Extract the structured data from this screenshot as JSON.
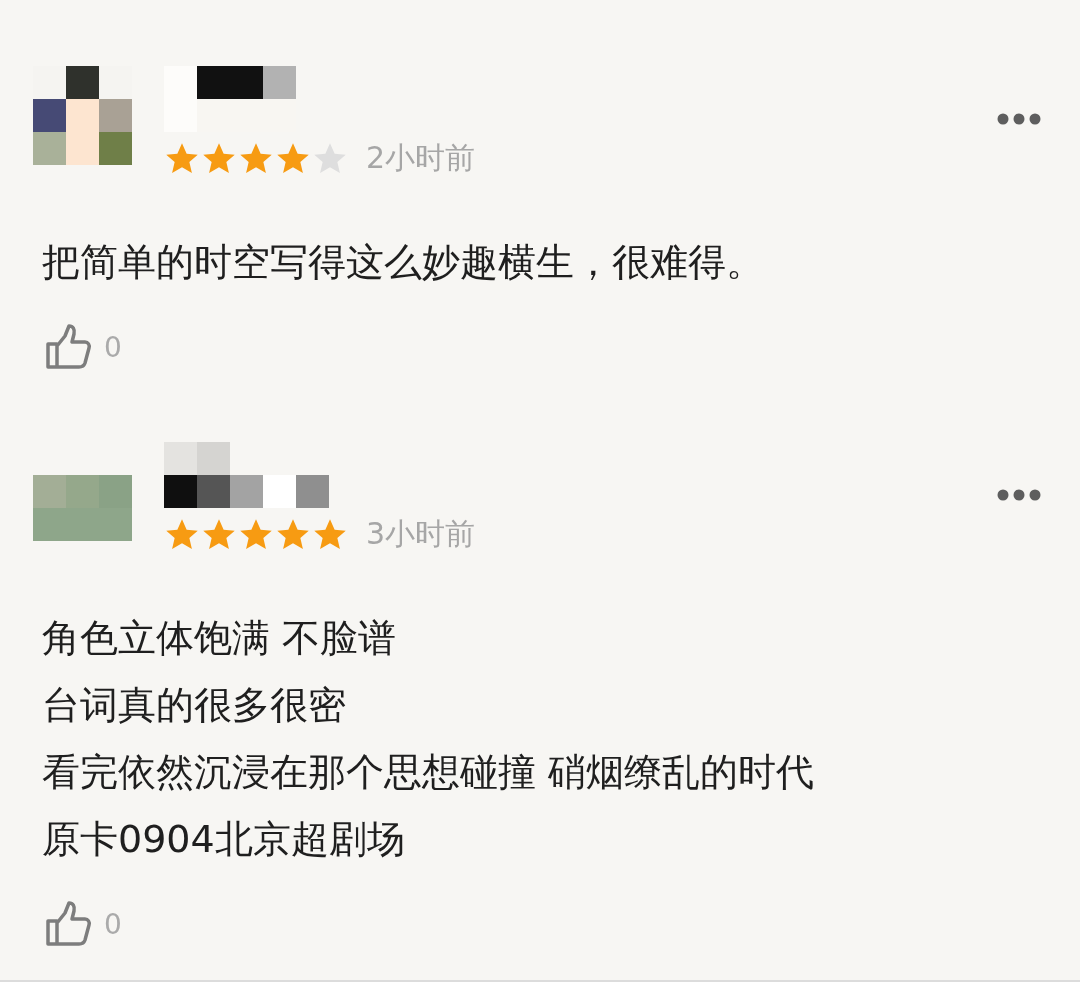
{
  "comments": [
    {
      "stars": 4,
      "time": "2小时前",
      "lines": [
        "把简单的时空写得这么妙趣横生，很难得。"
      ],
      "likes": "0"
    },
    {
      "stars": 5,
      "time": "3小时前",
      "lines": [
        "角色立体饱满 不脸谱",
        "台词真的很多很密",
        "看完依然沉浸在那个思想碰撞 硝烟缭乱的时代",
        "原卡0904北京超剧场"
      ],
      "likes": "0"
    }
  ]
}
